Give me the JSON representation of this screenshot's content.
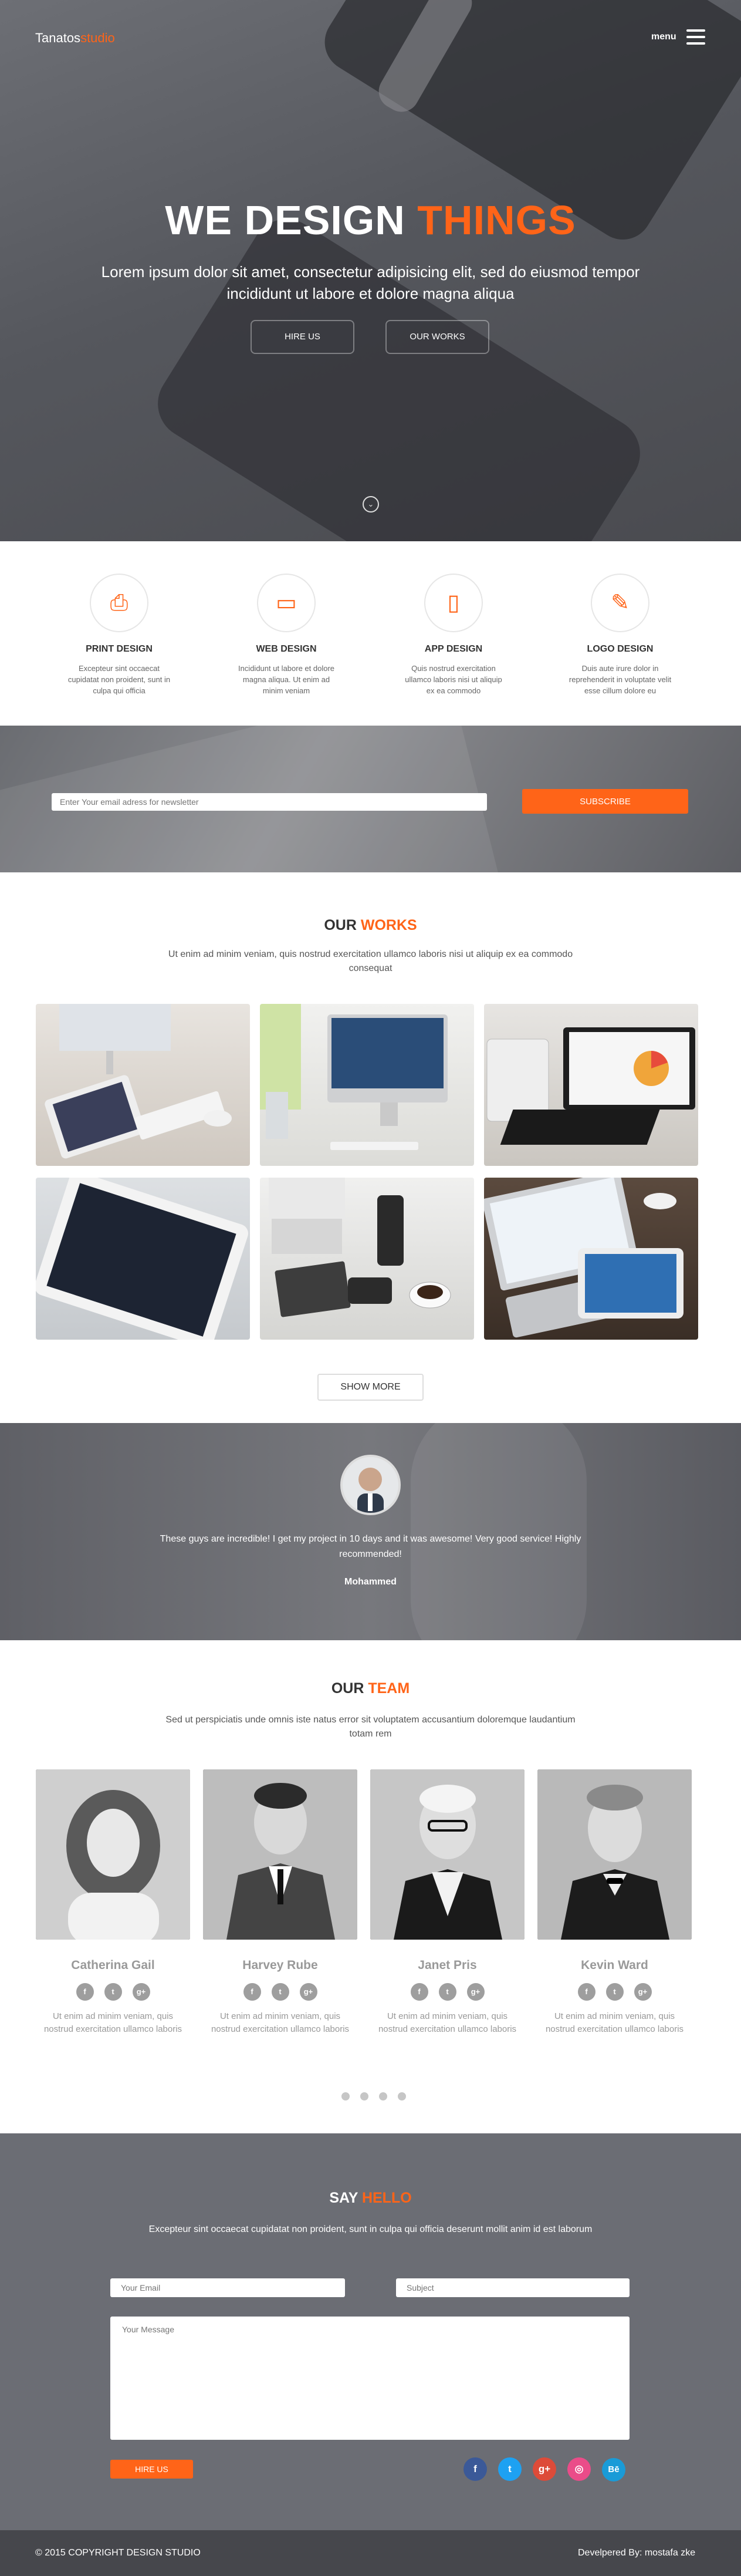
{
  "header": {
    "logo_main": "Tanatos",
    "logo_accent": "studio",
    "menu_label": "menu",
    "menu_icon": "hamburger-icon"
  },
  "hero": {
    "title_main": "WE DESIGN",
    "title_accent": "THINGS",
    "subtitle": "Lorem ipsum dolor sit amet, consectetur adipisicing elit, sed do eiusmod tempor incididunt ut labore et dolore magna aliqua",
    "hire_label": "HIRE US",
    "works_label": "OUR WORKS",
    "scroll_icon": "chevron-down-icon"
  },
  "services": [
    {
      "icon": "printer-icon",
      "glyph": "⎙",
      "title": "PRINT DESIGN",
      "text": "Excepteur sint occaecat cupidatat non proident, sunt in culpa qui officia"
    },
    {
      "icon": "monitor-icon",
      "glyph": "▭",
      "title": "WEB DESIGN",
      "text": "Incididunt ut labore et dolore magna aliqua. Ut enim ad minim veniam"
    },
    {
      "icon": "mobile-icon",
      "glyph": "▯",
      "title": "APP DESIGN",
      "text": "Quis nostrud exercitation ullamco laboris nisi ut aliquip ex ea commodo"
    },
    {
      "icon": "brush-icon",
      "glyph": "✎",
      "title": "LOGO DESIGN",
      "text": "Duis aute irure dolor in reprehenderit in voluptate velit esse cillum dolore eu"
    }
  ],
  "newsletter": {
    "placeholder": "Enter Your email adress for newsletter",
    "button": "SUBSCRIBE"
  },
  "works": {
    "title_main": "OUR",
    "title_accent": "WORKS",
    "lead": "Ut enim ad minim veniam, quis nostrud exercitation ullamco laboris nisi ut aliquip ex ea commodo consequat",
    "show_more": "SHOW MORE"
  },
  "testimonial": {
    "quote": "These guys are incredible! I get my project in 10 days and it was awesome! Very good service! Highly recommended!",
    "author": "Mohammed"
  },
  "team": {
    "title_main": "OUR",
    "title_accent": "TEAM",
    "lead": "Sed ut perspiciatis unde omnis iste natus error sit voluptatem accusantium doloremque laudantium totam rem",
    "members": [
      {
        "name": "Catherina Gail",
        "bio": "Ut enim ad minim veniam, quis nostrud exercitation ullamco laboris"
      },
      {
        "name": "Harvey Rube",
        "bio": "Ut enim ad minim veniam, quis nostrud exercitation ullamco laboris"
      },
      {
        "name": "Janet Pris",
        "bio": "Ut enim ad minim veniam, quis nostrud exercitation ullamco laboris"
      },
      {
        "name": "Kevin Ward",
        "bio": "Ut enim ad minim veniam, quis nostrud exercitation ullamco laboris"
      }
    ],
    "social_glyphs": {
      "facebook": "f",
      "twitter": "t",
      "googleplus": "g+"
    }
  },
  "contact": {
    "title_main": "SAY",
    "title_accent": "HELLO",
    "lead": "Excepteur sint occaecat cupidatat non proident, sunt in culpa qui officia deserunt mollit anim id est laborum",
    "email_placeholder": "Your Email",
    "subject_placeholder": "Subject",
    "message_placeholder": "Your Message",
    "button": "HIRE US",
    "socials": [
      {
        "icon": "facebook-icon",
        "glyph": "f",
        "color": "#3b5998"
      },
      {
        "icon": "twitter-icon",
        "glyph": "t",
        "color": "#1da1f2"
      },
      {
        "icon": "googleplus-icon",
        "glyph": "g+",
        "color": "#dd4b39"
      },
      {
        "icon": "dribbble-icon",
        "glyph": "◎",
        "color": "#ea4c89"
      },
      {
        "icon": "behance-icon",
        "glyph": "Bē",
        "color": "#1a9bd7"
      }
    ]
  },
  "footer": {
    "copyright": "© 2015 COPYRIGHT DESIGN STUDIO",
    "developer": "Develpered By: mostafa zke"
  },
  "colors": {
    "accent": "#ff6418",
    "dark_bg": "#6b6d74",
    "footer_bg": "#46474c"
  }
}
